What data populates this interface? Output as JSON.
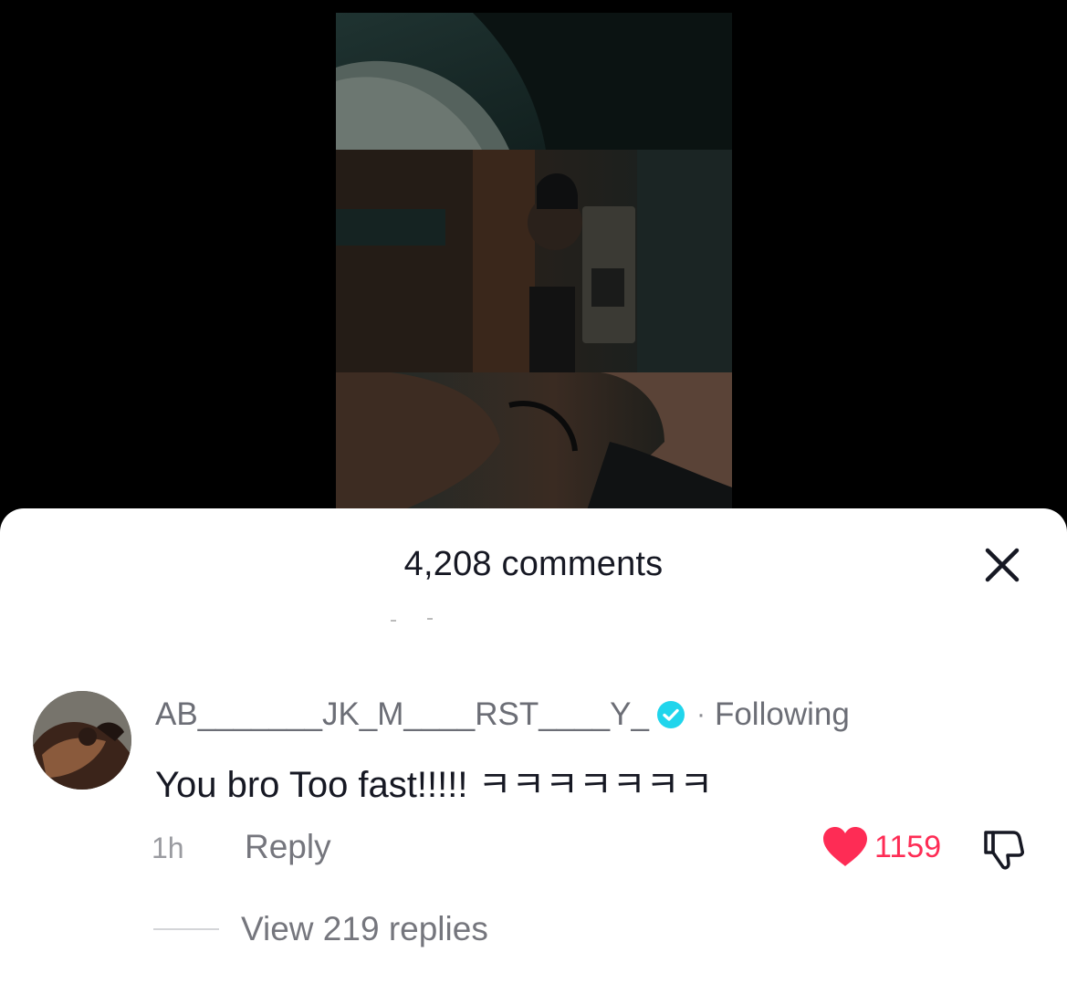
{
  "sheet": {
    "title": "4,208 comments"
  },
  "comment": {
    "username": "AB_______JK_M____RST____Y_",
    "separator": "·",
    "following_label": "Following",
    "text": "You bro Too fast!!!!! ㅋㅋㅋㅋㅋㅋㅋ",
    "time": "1h",
    "reply_label": "Reply",
    "like_count": "1159",
    "view_replies_label": "View 219 replies"
  },
  "colors": {
    "like": "#fe2c55",
    "verified": "#20d5ec",
    "sheet_background": "#ffffff",
    "page_background": "#000000"
  },
  "icons": {
    "close": "close-icon",
    "verified": "verified-badge-icon",
    "like": "heart-icon",
    "dislike": "thumbs-down-icon"
  }
}
